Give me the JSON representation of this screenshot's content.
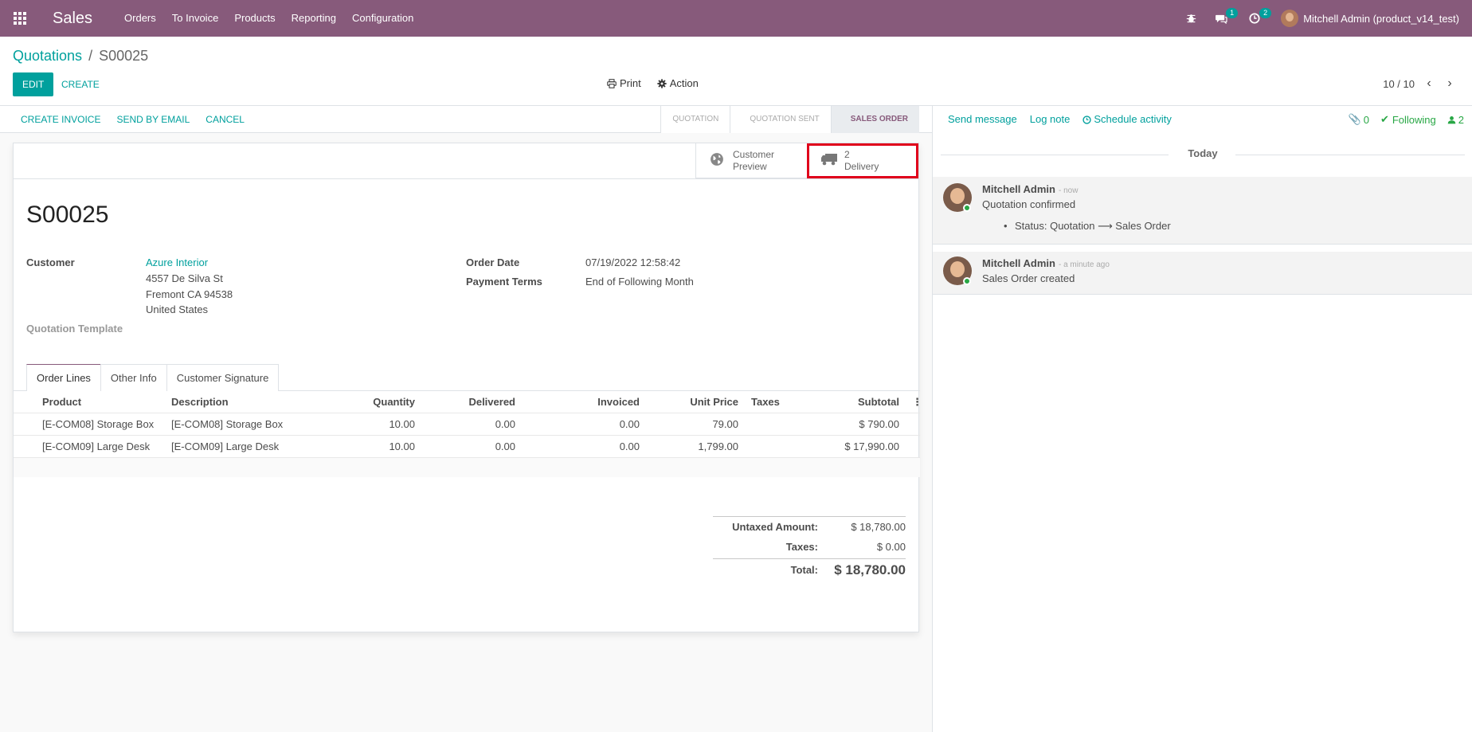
{
  "topbar": {
    "app_name": "Sales",
    "menu": [
      "Orders",
      "To Invoice",
      "Products",
      "Reporting",
      "Configuration"
    ],
    "messages_count": "1",
    "activities_count": "2",
    "user_name": "Mitchell Admin (product_v14_test)"
  },
  "control_panel": {
    "breadcrumb_parent": "Quotations",
    "breadcrumb_separator": "/",
    "breadcrumb_current": "S00025",
    "edit_label": "EDIT",
    "create_label": "CREATE",
    "print_label": "Print",
    "action_label": "Action",
    "pager": "10 / 10"
  },
  "statusbar": {
    "buttons": [
      "CREATE INVOICE",
      "SEND BY EMAIL",
      "CANCEL"
    ],
    "stages": [
      "QUOTATION",
      "QUOTATION SENT",
      "SALES ORDER"
    ],
    "active_stage": "SALES ORDER"
  },
  "smart_buttons": {
    "customer_preview": {
      "line1": "Customer",
      "line2": "Preview"
    },
    "delivery": {
      "count": "2",
      "label": "Delivery"
    }
  },
  "record": {
    "name": "S00025",
    "customer_label": "Customer",
    "customer_name": "Azure Interior",
    "address": [
      "4557 De Silva St",
      "Fremont CA 94538",
      "United States"
    ],
    "template_label": "Quotation Template",
    "order_date_label": "Order Date",
    "order_date": "07/19/2022 12:58:42",
    "payment_terms_label": "Payment Terms",
    "payment_terms": "End of Following Month"
  },
  "tabs": [
    "Order Lines",
    "Other Info",
    "Customer Signature"
  ],
  "order_lines": {
    "headers": {
      "product": "Product",
      "description": "Description",
      "quantity": "Quantity",
      "delivered": "Delivered",
      "invoiced": "Invoiced",
      "unit_price": "Unit Price",
      "taxes": "Taxes",
      "subtotal": "Subtotal"
    },
    "rows": [
      {
        "product": "[E-COM08] Storage Box",
        "description": "[E-COM08] Storage Box",
        "quantity": "10.00",
        "delivered": "0.00",
        "invoiced": "0.00",
        "unit_price": "79.00",
        "taxes": "",
        "subtotal": "$ 790.00"
      },
      {
        "product": "[E-COM09] Large Desk",
        "description": "[E-COM09] Large Desk",
        "quantity": "10.00",
        "delivered": "0.00",
        "invoiced": "0.00",
        "unit_price": "1,799.00",
        "taxes": "",
        "subtotal": "$ 17,990.00"
      }
    ]
  },
  "totals": {
    "untaxed_label": "Untaxed Amount:",
    "untaxed": "$ 18,780.00",
    "taxes_label": "Taxes:",
    "taxes": "$ 0.00",
    "total_label": "Total:",
    "total": "$ 18,780.00"
  },
  "chatter": {
    "send_message": "Send message",
    "log_note": "Log note",
    "schedule_activity": "Schedule activity",
    "attachments": "0",
    "following": "Following",
    "followers": "2",
    "date_separator": "Today",
    "messages": [
      {
        "author": "Mitchell Admin",
        "when": "- now",
        "body": "Quotation confirmed",
        "tracking": "Status: Quotation ⟶ Sales Order"
      },
      {
        "author": "Mitchell Admin",
        "when": "- a minute ago",
        "body": "Sales Order created"
      }
    ]
  }
}
